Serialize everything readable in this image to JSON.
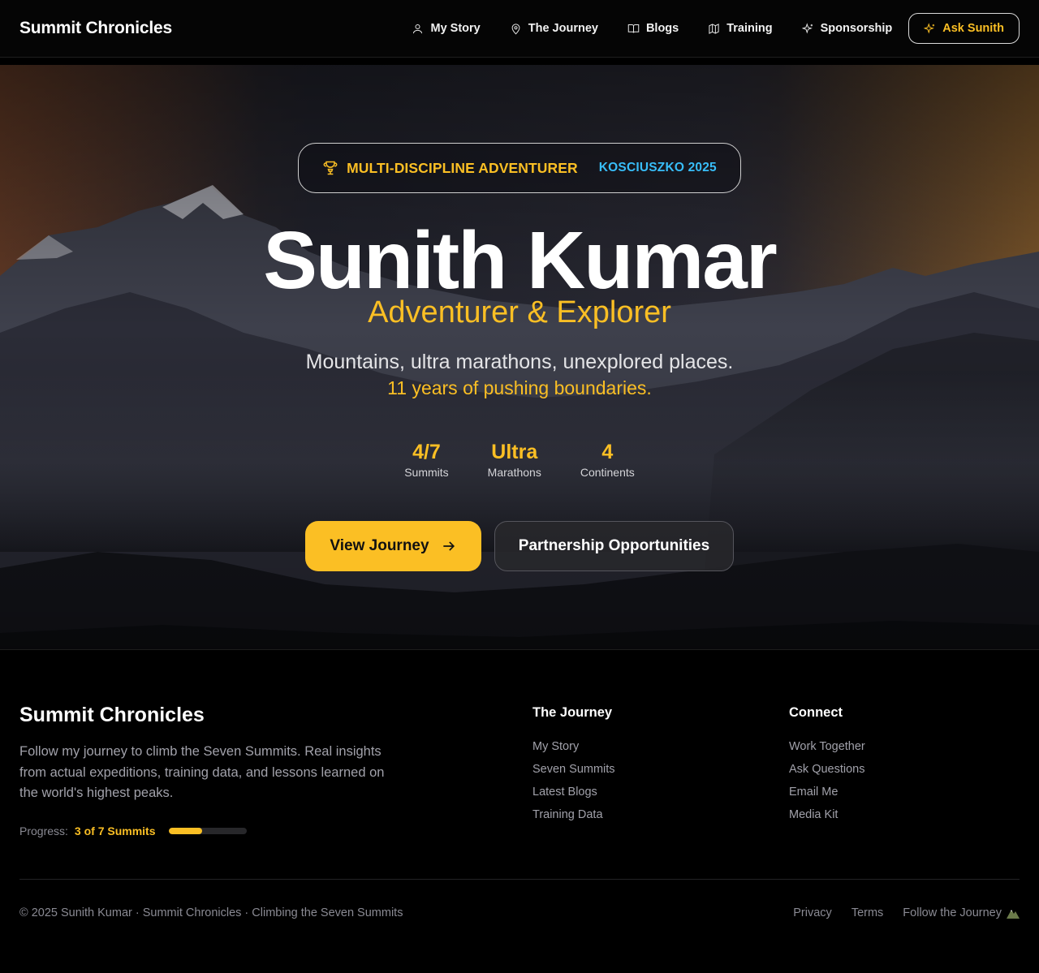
{
  "nav": {
    "brand": "Summit Chronicles",
    "items": [
      {
        "label": "My Story",
        "icon": "user-icon"
      },
      {
        "label": "The Journey",
        "icon": "map-pin-icon"
      },
      {
        "label": "Blogs",
        "icon": "book-icon"
      },
      {
        "label": "Training",
        "icon": "map-icon"
      },
      {
        "label": "Sponsorship",
        "icon": "sparkles-icon"
      }
    ],
    "cta": {
      "label": "Ask Sunith",
      "icon": "sparkles-icon"
    }
  },
  "hero": {
    "badge": {
      "main": "MULTI-DISCIPLINE ADVENTURER",
      "sub": "KOSCIUSZKO 2025",
      "icon": "trophy-icon"
    },
    "name": "Sunith Kumar",
    "role": "Adventurer & Explorer",
    "tagline": "Mountains, ultra marathons, unexplored places.",
    "tagline_highlight": "11 years of pushing boundaries.",
    "stats": [
      {
        "value": "4/7",
        "label": "Summits"
      },
      {
        "value": "Ultra",
        "label": "Marathons"
      },
      {
        "value": "4",
        "label": "Continents"
      }
    ],
    "primary_button": "View Journey",
    "secondary_button": "Partnership Opportunities"
  },
  "footer": {
    "brand": "Summit Chronicles",
    "description": "Follow my journey to climb the Seven Summits. Real insights from actual expeditions, training data, and lessons learned on the world's highest peaks.",
    "progress": {
      "label": "Progress:",
      "value": "3 of 7 Summits",
      "fraction": 0.43
    },
    "columns": [
      {
        "title": "The Journey",
        "links": [
          "My Story",
          "Seven Summits",
          "Latest Blogs",
          "Training Data"
        ]
      },
      {
        "title": "Connect",
        "links": [
          "Work Together",
          "Ask Questions",
          "Email Me",
          "Media Kit"
        ]
      }
    ],
    "copyright": "© 2025 Sunith Kumar · Summit Chronicles · Climbing the Seven Summits",
    "bottom_links": [
      "Privacy",
      "Terms",
      "Follow the Journey"
    ]
  },
  "colors": {
    "accent": "#fbbf24",
    "badge_sub": "#38bdf8",
    "background": "#000000"
  }
}
